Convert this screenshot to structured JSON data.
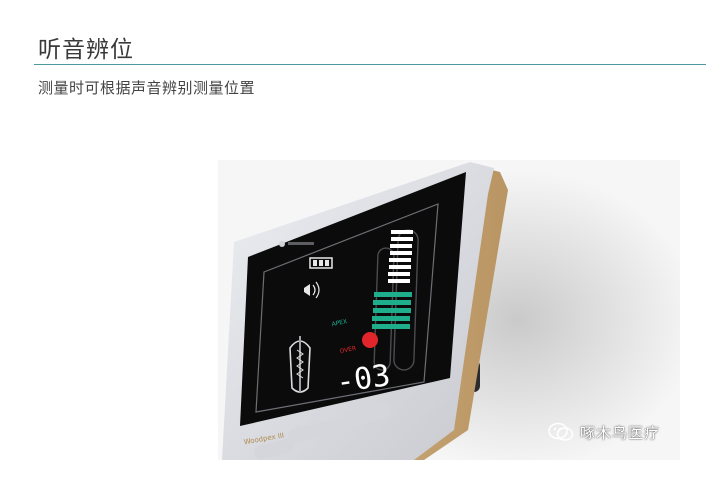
{
  "heading": "听音辨位",
  "description": "测量时可根据声音辨别测量位置",
  "device": {
    "brand_text": "Woodpex III",
    "apex_label": "APEX",
    "over_label": "OVER",
    "readout": "-03",
    "colors": {
      "screen": "#0b0b0c",
      "green_bar": "#1fae8c",
      "red_dot": "#e0262b",
      "white_bar": "#ffffff",
      "bezel": "#dcdde2",
      "gold_edge": "#c9a772"
    }
  },
  "watermark": {
    "text": "啄木鸟医疗",
    "icon": "wechat-icon"
  }
}
